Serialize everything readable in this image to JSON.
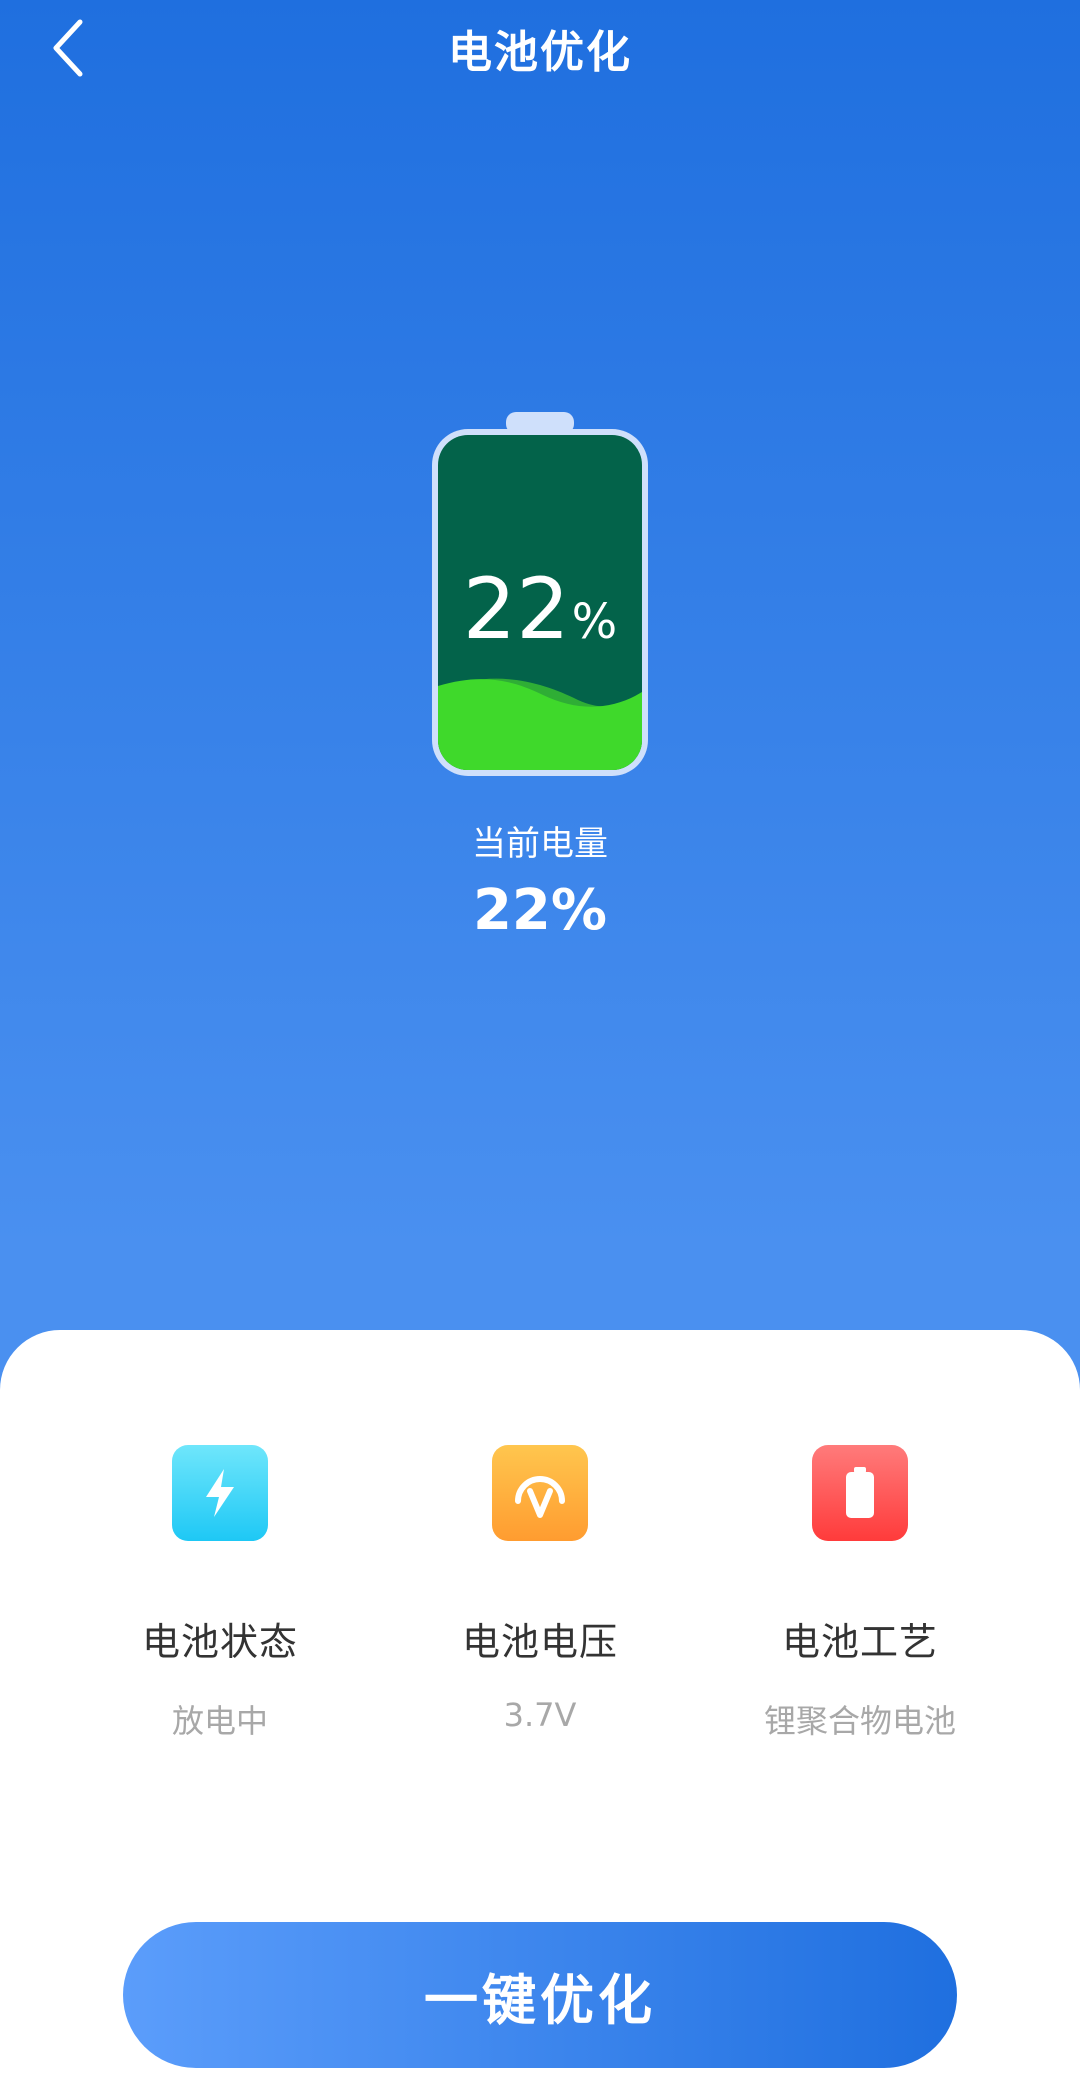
{
  "header": {
    "title": "电池优化",
    "back_icon": "chevron-left-icon"
  },
  "battery": {
    "level_percent": 22,
    "level_number": "22",
    "level_unit": "%",
    "frame_color": "#cfe0fb",
    "fill_dark": "#03634a",
    "fill_green": "#3fd92b"
  },
  "current": {
    "label": "当前电量",
    "value": "22%"
  },
  "stats": [
    {
      "icon": "lightning-icon",
      "label": "电池状态",
      "value": "放电中",
      "color": "#26d0f7"
    },
    {
      "icon": "voltage-gauge-icon",
      "label": "电池电压",
      "value": "3.7V",
      "color": "#ffad3a"
    },
    {
      "icon": "battery-icon",
      "label": "电池工艺",
      "value": "锂聚合物电池",
      "color": "#ff4a4a"
    }
  ],
  "optimize_button": {
    "label": "一键优化"
  }
}
